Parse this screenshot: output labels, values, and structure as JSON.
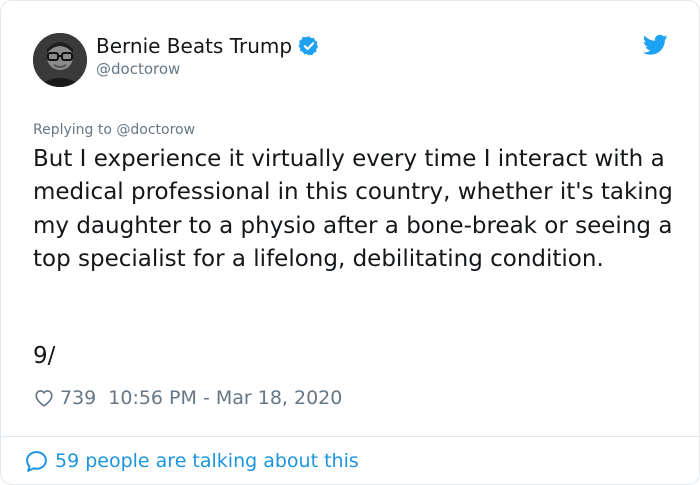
{
  "tweet": {
    "author": {
      "display_name": "Bernie Beats Trump",
      "handle": "@doctorow",
      "verified": true,
      "avatar": "profile-photo"
    },
    "reply_context": "Replying to @doctorow",
    "text": "But I experience it virtually every time I interact with a medical professional in this country, whether it's taking my daughter to a physio after a bone-break or seeing a top specialist for a lifelong, debilitating condition.",
    "thread_number": "9/",
    "like_count": "739",
    "timestamp": "10:56 PM - Mar 18, 2020"
  },
  "footer": {
    "conversation_label": "59 people are talking about this"
  },
  "icons": {
    "brand": "twitter-bird-icon",
    "verified": "verified-badge-icon",
    "like": "heart-icon",
    "conversation": "speech-bubble-icon"
  },
  "colors": {
    "brand_blue": "#1da1f2",
    "link_blue": "#1b95e0",
    "text_primary": "#14171a",
    "text_secondary": "#657786",
    "border": "#e1e8ed"
  }
}
